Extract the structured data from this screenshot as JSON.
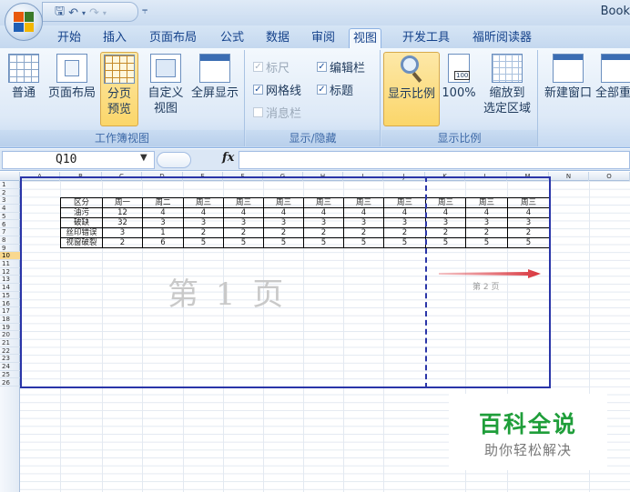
{
  "app": {
    "title_partial": "Book"
  },
  "tabs": [
    "开始",
    "插入",
    "页面布局",
    "公式",
    "数据",
    "审阅",
    "视图",
    "开发工具",
    "福昕阅读器"
  ],
  "active_tab": "视图",
  "ribbon": {
    "workbook_views": {
      "label": "工作簿视图",
      "normal": "普通",
      "page_layout": "页面布局",
      "page_break_preview_line1": "分页",
      "page_break_preview_line2": "预览",
      "custom_views_line1": "自定义",
      "custom_views_line2": "视图",
      "full_screen": "全屏显示"
    },
    "show_hide": {
      "label": "显示/隐藏",
      "ruler": "标尺",
      "formula_bar": "编辑栏",
      "gridlines": "网格线",
      "headings": "标题",
      "message_bar": "消息栏"
    },
    "zoom": {
      "label": "显示比例",
      "zoom": "显示比例",
      "hundred": "100%",
      "zoom_to_selection_line1": "缩放到",
      "zoom_to_selection_line2": "选定区域"
    },
    "window": {
      "new_window": "新建窗口",
      "arrange_all": "全部重"
    }
  },
  "formula_bar": {
    "name_box": "Q10",
    "fx": "fx",
    "value": ""
  },
  "columns": [
    "A",
    "B",
    "C",
    "D",
    "E",
    "F",
    "G",
    "H",
    "I",
    "J",
    "K",
    "L",
    "M",
    "N",
    "O"
  ],
  "rows": [
    "1",
    "2",
    "3",
    "4",
    "5",
    "6",
    "7",
    "8",
    "9",
    "10",
    "11",
    "12",
    "13",
    "14",
    "15",
    "16",
    "17",
    "18",
    "19",
    "20",
    "21",
    "22",
    "23",
    "24",
    "25",
    "26"
  ],
  "selected_row": "10",
  "table": {
    "header": [
      "区分",
      "周一",
      "周二",
      "周三",
      "周三",
      "周三",
      "周三",
      "周三",
      "周三",
      "周三",
      "周三",
      "周三"
    ],
    "rows": [
      [
        "油污",
        "12",
        "4",
        "4",
        "4",
        "4",
        "4",
        "4",
        "4",
        "4",
        "4",
        "4"
      ],
      [
        "破缺",
        "32",
        "3",
        "3",
        "3",
        "3",
        "3",
        "3",
        "3",
        "3",
        "3",
        "3"
      ],
      [
        "丝印错误",
        "3",
        "1",
        "2",
        "2",
        "2",
        "2",
        "2",
        "2",
        "2",
        "2",
        "2"
      ],
      [
        "视窗破裂",
        "2",
        "6",
        "5",
        "5",
        "5",
        "5",
        "5",
        "5",
        "5",
        "5",
        "5"
      ]
    ]
  },
  "page_labels": {
    "page1": "第 1 页",
    "page2": "第 2 页"
  },
  "watermark": {
    "title": "百科全说",
    "subtitle": "助你轻松解决"
  },
  "colors": {
    "page_border": "#2a35a8",
    "arrow": "#d9363e",
    "watermark_green": "#1f9e3a",
    "selected_row": "#f9d88f"
  }
}
